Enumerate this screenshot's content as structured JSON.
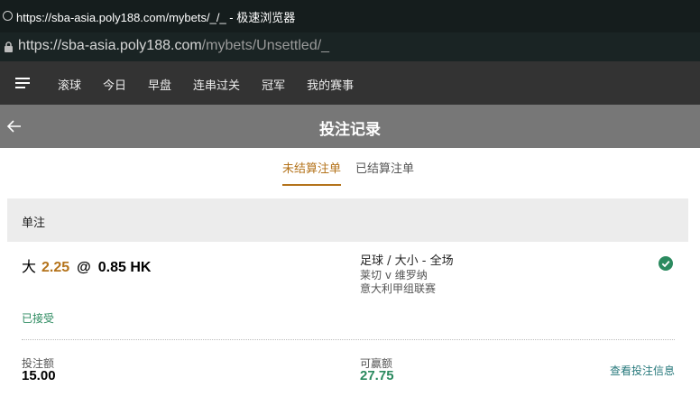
{
  "browser": {
    "window_title": "https://sba-asia.poly188.com/mybets/_/_ - 极速浏览器",
    "url_host": "https://sba-asia.poly188.com",
    "url_path": "/mybets/Unsettled/_"
  },
  "nav": {
    "tabs": [
      "滚球",
      "今日",
      "早盘",
      "连串过关",
      "冠军",
      "我的赛事"
    ]
  },
  "page": {
    "title": "投注记录",
    "tab_unsettled": "未结算注单",
    "tab_settled": "已结算注单"
  },
  "section": {
    "title": "单注"
  },
  "bet": {
    "selection": "大",
    "line": "2.25",
    "at": "@",
    "odds": "0.85 HK",
    "market": "足球 / 大小 - 全场",
    "match": "莱切 v 维罗纳",
    "league": "意大利甲组联赛",
    "status": "已接受",
    "stake_label": "投注额",
    "stake_value": "15.00",
    "win_label": "可赢额",
    "win_value": "27.75",
    "details_link": "查看投注信息"
  },
  "colors": {
    "accent": "#b4731b",
    "success": "#2b8a5f",
    "link": "#26787b",
    "navbar": "#333333",
    "header": "#777777"
  },
  "icons": {
    "menu": "hamburger-menu-icon",
    "back": "back-arrow-icon",
    "status": "check-circle-icon",
    "lock": "lock-icon",
    "favicon": "globe-icon"
  }
}
